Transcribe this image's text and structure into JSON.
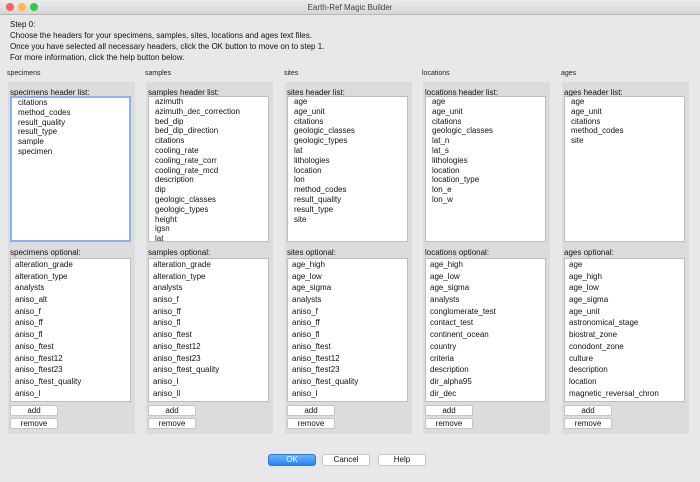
{
  "window": {
    "title": "Earth-Ref Magic Builder"
  },
  "intro": {
    "line1": "Step 0:",
    "line2": "Choose the headers for your specimens, samples, sites, locations and ages text files.",
    "line3": "Once you have selected all necessary headers, click the OK button to move on to step 1.",
    "line4": "For more information, click the help button below."
  },
  "columns": [
    {
      "label": "specimens",
      "header_label": "specimens header list:",
      "header_items": [
        "citations",
        "method_codes",
        "result_quality",
        "result_type",
        "sample",
        "specimen"
      ],
      "optional_label": "specimens optional:",
      "optional_items": [
        "alteration_grade",
        "alteration_type",
        "analysts",
        "aniso_alt",
        "aniso_f",
        "aniso_ff",
        "aniso_fl",
        "aniso_ftest",
        "aniso_ftest12",
        "aniso_ftest23",
        "aniso_ftest_quality",
        "aniso_l"
      ],
      "add_label": "add",
      "remove_label": "remove"
    },
    {
      "label": "samples",
      "header_label": "samples header list:",
      "header_items": [
        "azimuth",
        "azimuth_dec_correction",
        "bed_dip",
        "bed_dip_direction",
        "citations",
        "cooling_rate",
        "cooling_rate_corr",
        "cooling_rate_mcd",
        "description",
        "dip",
        "geologic_classes",
        "geologic_types",
        "height",
        "igsn",
        "lat",
        "lithologies"
      ],
      "optional_label": "samples optional:",
      "optional_items": [
        "alteration_grade",
        "alteration_type",
        "analysts",
        "aniso_f",
        "aniso_ff",
        "aniso_fl",
        "aniso_ftest",
        "aniso_ftest12",
        "aniso_ftest23",
        "aniso_ftest_quality",
        "aniso_l",
        "aniso_ll"
      ],
      "add_label": "add",
      "remove_label": "remove"
    },
    {
      "label": "sites",
      "header_label": "sites header list:",
      "header_items": [
        "age",
        "age_unit",
        "citations",
        "geologic_classes",
        "geologic_types",
        "lat",
        "lithologies",
        "location",
        "lon",
        "method_codes",
        "result_quality",
        "result_type",
        "site"
      ],
      "optional_label": "sites optional:",
      "optional_items": [
        "age_high",
        "age_low",
        "age_sigma",
        "analysts",
        "aniso_f",
        "aniso_ff",
        "aniso_fl",
        "aniso_ftest",
        "aniso_ftest12",
        "aniso_ftest23",
        "aniso_ftest_quality",
        "aniso_l"
      ],
      "add_label": "add",
      "remove_label": "remove"
    },
    {
      "label": "locations",
      "header_label": "locations header list:",
      "header_items": [
        "age",
        "age_unit",
        "citations",
        "geologic_classes",
        "lat_n",
        "lat_s",
        "lithologies",
        "location",
        "location_type",
        "lon_e",
        "lon_w"
      ],
      "optional_label": "locations optional:",
      "optional_items": [
        "age_high",
        "age_low",
        "age_sigma",
        "analysts",
        "conglomerate_test",
        "contact_test",
        "continent_ocean",
        "country",
        "criteria",
        "description",
        "dir_alpha95",
        "dir_dec"
      ],
      "add_label": "add",
      "remove_label": "remove"
    },
    {
      "label": "ages",
      "header_label": "ages header list:",
      "header_items": [
        "age",
        "age_unit",
        "citations",
        "method_codes",
        "site"
      ],
      "optional_label": "ages optional:",
      "optional_items": [
        "age",
        "age_high",
        "age_low",
        "age_sigma",
        "age_unit",
        "astronomical_stage",
        "biostrat_zone",
        "conodont_zone",
        "culture",
        "description",
        "location",
        "magnetic_reversal_chron"
      ],
      "add_label": "add",
      "remove_label": "remove"
    }
  ],
  "footer": {
    "ok_label": "OK",
    "cancel_label": "Cancel",
    "help_label": "Help"
  },
  "colors": {
    "close": "#fc605c",
    "minimize": "#fdbc40",
    "zoom": "#34c84a",
    "focus": "#8ab4e8",
    "primary": "#2a85f0"
  }
}
